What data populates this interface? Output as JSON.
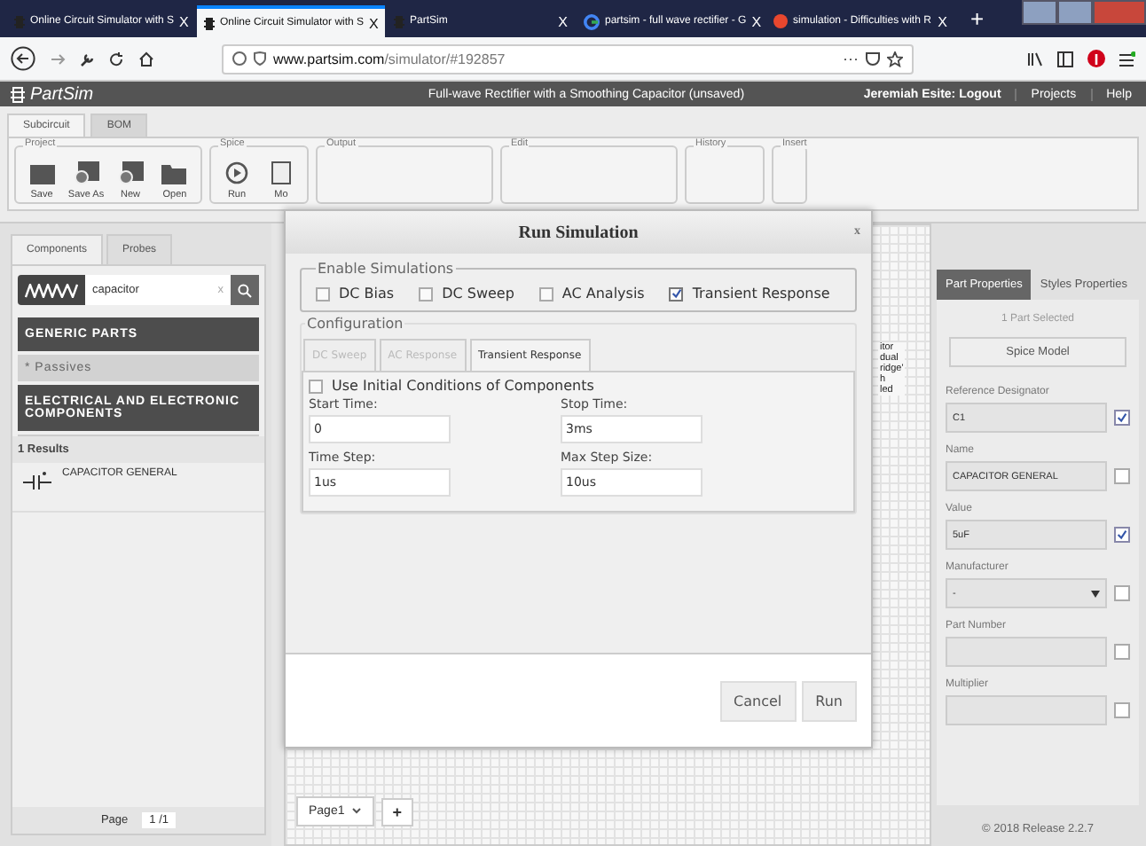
{
  "browser": {
    "tabs": [
      {
        "title": "Online Circuit Simulator with S",
        "kind": "chip",
        "selected": false,
        "close": "X"
      },
      {
        "title": "Online Circuit Simulator with S",
        "kind": "chip",
        "selected": true,
        "close": "X"
      },
      {
        "title": "PartSim",
        "kind": "chip",
        "selected": false,
        "close": "X"
      },
      {
        "title": "partsim - full wave rectifier - G",
        "kind": "google",
        "selected": false,
        "close": "X"
      },
      {
        "title": "simulation - Difficulties with R",
        "kind": "dot",
        "selected": false,
        "close": "X"
      }
    ],
    "new_tab": "+",
    "url_domain": "www.partsim.com",
    "url_path": "/simulator/#192857",
    "more": "···"
  },
  "app": {
    "logo": "PartSim",
    "document_title": "Full-wave Rectifier with a Smoothing Capacitor (unsaved)",
    "user": "Jeremiah Esite: Logout",
    "nav": [
      "Projects",
      "Help"
    ]
  },
  "ribbon": {
    "tabs": [
      {
        "label": "Subcircuit",
        "selected": true
      },
      {
        "label": "BOM",
        "selected": false
      }
    ],
    "groups": [
      {
        "legend": "Project",
        "buttons": [
          {
            "label": "Save",
            "kind": "save"
          },
          {
            "label": "Save As",
            "kind": "saveas"
          },
          {
            "label": "New",
            "kind": "new"
          },
          {
            "label": "Open",
            "kind": "open"
          }
        ]
      },
      {
        "legend": "Spice",
        "buttons": [
          {
            "label": "Run",
            "kind": "run"
          },
          {
            "label": "Mo",
            "kind": "doc"
          }
        ]
      },
      {
        "legend": "Output"
      },
      {
        "legend": "Edit"
      },
      {
        "legend": "History"
      },
      {
        "legend": "Insert"
      }
    ]
  },
  "left_panel": {
    "tabs": [
      {
        "label": "Components",
        "selected": true
      },
      {
        "label": "Probes",
        "selected": false
      }
    ],
    "search": {
      "value": "capacitor",
      "clear": "x"
    },
    "categories": [
      {
        "label": "GENERIC PARTS",
        "kind": "header"
      },
      {
        "label": "* Passives",
        "kind": "item"
      },
      {
        "label": "ELECTRICAL AND ELECTRONIC COMPONENTS",
        "kind": "header"
      }
    ],
    "results_count": "1 Results",
    "results": [
      {
        "name": "CAPACITOR GENERAL"
      }
    ],
    "pager": {
      "label": "Page",
      "value": "1",
      "total": "/1"
    }
  },
  "canvas": {
    "fragments": [
      "itor",
      "dual",
      "ridge'",
      "h",
      "led"
    ],
    "page_tab": "Page1",
    "add_page": "+"
  },
  "dialog": {
    "title": "Run Simulation",
    "close": "x",
    "enable_legend": "Enable Simulations",
    "simulations": [
      {
        "label": "DC Bias",
        "checked": false
      },
      {
        "label": "DC Sweep",
        "checked": false
      },
      {
        "label": "AC Analysis",
        "checked": false
      },
      {
        "label": "Transient Response",
        "checked": true
      }
    ],
    "config_legend": "Configuration",
    "tabs": [
      {
        "label": "DC Sweep",
        "selected": false,
        "disabled": true
      },
      {
        "label": "AC Response",
        "selected": false,
        "disabled": true
      },
      {
        "label": "Transient Response",
        "selected": true,
        "disabled": false
      }
    ],
    "initial_conditions": {
      "label": "Use Initial Conditions of Components",
      "checked": false
    },
    "fields": [
      {
        "label": "Start Time:",
        "value": "0"
      },
      {
        "label": "Stop Time:",
        "value": "3ms"
      },
      {
        "label": "Time Step:",
        "value": "1us"
      },
      {
        "label": "Max Step Size:",
        "value": "10us"
      }
    ],
    "buttons": [
      "Cancel",
      "Run"
    ]
  },
  "right_panel": {
    "tabs": [
      {
        "label": "Part Properties",
        "selected": true
      },
      {
        "label": "Styles Properties",
        "selected": false
      }
    ],
    "selection": "1 Part Selected",
    "spice_button": "Spice Model",
    "properties": [
      {
        "label": "Reference Designator",
        "kind": "input",
        "value": "C1",
        "checked": true
      },
      {
        "label": "Name",
        "kind": "input",
        "value": "CAPACITOR GENERAL",
        "checked": false
      },
      {
        "label": "Value",
        "kind": "input",
        "value": "5uF",
        "checked": true
      },
      {
        "label": "Manufacturer",
        "kind": "select",
        "value": "-",
        "checked": false
      },
      {
        "label": "Part Number",
        "kind": "input",
        "checked": false
      },
      {
        "label": "Multiplier",
        "kind": "input",
        "checked": false
      }
    ],
    "footer": "© 2018 Release 2.2.7"
  }
}
